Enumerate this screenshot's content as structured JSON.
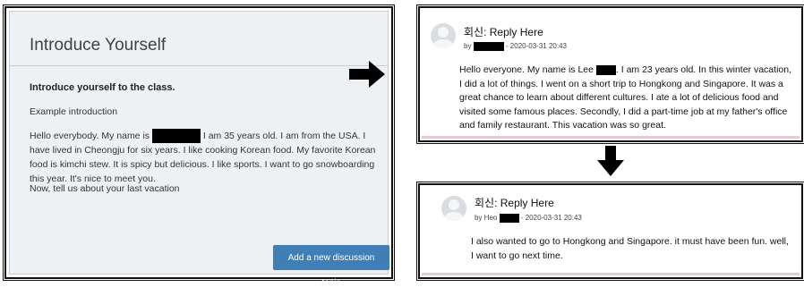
{
  "intro": {
    "title": "Introduce Yourself",
    "subtitle": "Introduce yourself to the class.",
    "example_label": "Example introduction",
    "body_before": "Hello everybody. My name is ",
    "body_after": " I am 35 years old. I am from the USA. I have lived in Cheongju for six years. I like cooking Korean food. My favorite Korean food is kimchi stew. It is spicy but delicious. I like sports. I want to go snowboarding this year.  It's nice to meet you.",
    "prompt": "Now, tell us about your last vacation",
    "add_button": "Add a new discussion topic"
  },
  "arrows": {
    "right": "arrow-right-icon",
    "down": "arrow-down-icon"
  },
  "reply1": {
    "title": "회신: Reply Here",
    "meta_prefix": "by",
    "meta_suffix": "- 2020-03-31 20:43",
    "body_before": "Hello everyone. My name is Lee ",
    "body_after": ". I am 23 years old. In this winter vacation, I did a lot of things. I went on a short trip to Hongkong and Singapore. It was a great chance to learn about different cultures. I ate a lot of delicious food and visited some famous places. Secondly, I did a part-time job at my father's office and family restaurant. This vacation was so great."
  },
  "reply2": {
    "title": "회신: Reply Here",
    "meta_prefix": "by Heo",
    "meta_suffix": "- 2020-03-31 20:43",
    "body": "I also wanted to go to Hongkong and Singapore. it must have been fun. well, I want to go next time."
  },
  "colors": {
    "button": "#3f7fb8",
    "panel_bg": "#eef1f4",
    "frame": "#111111"
  }
}
